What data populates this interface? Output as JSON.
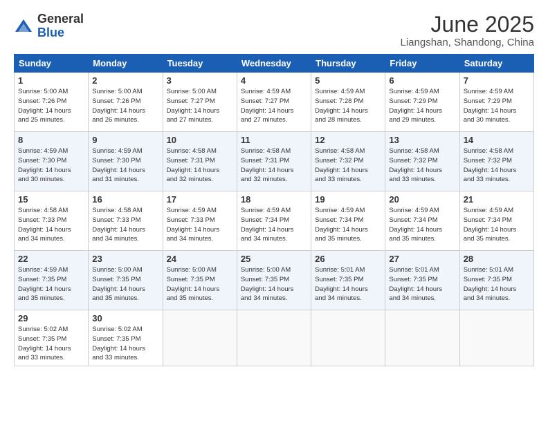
{
  "header": {
    "logo_general": "General",
    "logo_blue": "Blue",
    "month_title": "June 2025",
    "location": "Liangshan, Shandong, China"
  },
  "days_of_week": [
    "Sunday",
    "Monday",
    "Tuesday",
    "Wednesday",
    "Thursday",
    "Friday",
    "Saturday"
  ],
  "weeks": [
    [
      {
        "day": "1",
        "info": "Sunrise: 5:00 AM\nSunset: 7:26 PM\nDaylight: 14 hours\nand 25 minutes."
      },
      {
        "day": "2",
        "info": "Sunrise: 5:00 AM\nSunset: 7:26 PM\nDaylight: 14 hours\nand 26 minutes."
      },
      {
        "day": "3",
        "info": "Sunrise: 5:00 AM\nSunset: 7:27 PM\nDaylight: 14 hours\nand 27 minutes."
      },
      {
        "day": "4",
        "info": "Sunrise: 4:59 AM\nSunset: 7:27 PM\nDaylight: 14 hours\nand 27 minutes."
      },
      {
        "day": "5",
        "info": "Sunrise: 4:59 AM\nSunset: 7:28 PM\nDaylight: 14 hours\nand 28 minutes."
      },
      {
        "day": "6",
        "info": "Sunrise: 4:59 AM\nSunset: 7:29 PM\nDaylight: 14 hours\nand 29 minutes."
      },
      {
        "day": "7",
        "info": "Sunrise: 4:59 AM\nSunset: 7:29 PM\nDaylight: 14 hours\nand 30 minutes."
      }
    ],
    [
      {
        "day": "8",
        "info": "Sunrise: 4:59 AM\nSunset: 7:30 PM\nDaylight: 14 hours\nand 30 minutes."
      },
      {
        "day": "9",
        "info": "Sunrise: 4:59 AM\nSunset: 7:30 PM\nDaylight: 14 hours\nand 31 minutes."
      },
      {
        "day": "10",
        "info": "Sunrise: 4:58 AM\nSunset: 7:31 PM\nDaylight: 14 hours\nand 32 minutes."
      },
      {
        "day": "11",
        "info": "Sunrise: 4:58 AM\nSunset: 7:31 PM\nDaylight: 14 hours\nand 32 minutes."
      },
      {
        "day": "12",
        "info": "Sunrise: 4:58 AM\nSunset: 7:32 PM\nDaylight: 14 hours\nand 33 minutes."
      },
      {
        "day": "13",
        "info": "Sunrise: 4:58 AM\nSunset: 7:32 PM\nDaylight: 14 hours\nand 33 minutes."
      },
      {
        "day": "14",
        "info": "Sunrise: 4:58 AM\nSunset: 7:32 PM\nDaylight: 14 hours\nand 33 minutes."
      }
    ],
    [
      {
        "day": "15",
        "info": "Sunrise: 4:58 AM\nSunset: 7:33 PM\nDaylight: 14 hours\nand 34 minutes."
      },
      {
        "day": "16",
        "info": "Sunrise: 4:58 AM\nSunset: 7:33 PM\nDaylight: 14 hours\nand 34 minutes."
      },
      {
        "day": "17",
        "info": "Sunrise: 4:59 AM\nSunset: 7:33 PM\nDaylight: 14 hours\nand 34 minutes."
      },
      {
        "day": "18",
        "info": "Sunrise: 4:59 AM\nSunset: 7:34 PM\nDaylight: 14 hours\nand 34 minutes."
      },
      {
        "day": "19",
        "info": "Sunrise: 4:59 AM\nSunset: 7:34 PM\nDaylight: 14 hours\nand 35 minutes."
      },
      {
        "day": "20",
        "info": "Sunrise: 4:59 AM\nSunset: 7:34 PM\nDaylight: 14 hours\nand 35 minutes."
      },
      {
        "day": "21",
        "info": "Sunrise: 4:59 AM\nSunset: 7:34 PM\nDaylight: 14 hours\nand 35 minutes."
      }
    ],
    [
      {
        "day": "22",
        "info": "Sunrise: 4:59 AM\nSunset: 7:35 PM\nDaylight: 14 hours\nand 35 minutes."
      },
      {
        "day": "23",
        "info": "Sunrise: 5:00 AM\nSunset: 7:35 PM\nDaylight: 14 hours\nand 35 minutes."
      },
      {
        "day": "24",
        "info": "Sunrise: 5:00 AM\nSunset: 7:35 PM\nDaylight: 14 hours\nand 35 minutes."
      },
      {
        "day": "25",
        "info": "Sunrise: 5:00 AM\nSunset: 7:35 PM\nDaylight: 14 hours\nand 34 minutes."
      },
      {
        "day": "26",
        "info": "Sunrise: 5:01 AM\nSunset: 7:35 PM\nDaylight: 14 hours\nand 34 minutes."
      },
      {
        "day": "27",
        "info": "Sunrise: 5:01 AM\nSunset: 7:35 PM\nDaylight: 14 hours\nand 34 minutes."
      },
      {
        "day": "28",
        "info": "Sunrise: 5:01 AM\nSunset: 7:35 PM\nDaylight: 14 hours\nand 34 minutes."
      }
    ],
    [
      {
        "day": "29",
        "info": "Sunrise: 5:02 AM\nSunset: 7:35 PM\nDaylight: 14 hours\nand 33 minutes."
      },
      {
        "day": "30",
        "info": "Sunrise: 5:02 AM\nSunset: 7:35 PM\nDaylight: 14 hours\nand 33 minutes."
      },
      null,
      null,
      null,
      null,
      null
    ]
  ]
}
